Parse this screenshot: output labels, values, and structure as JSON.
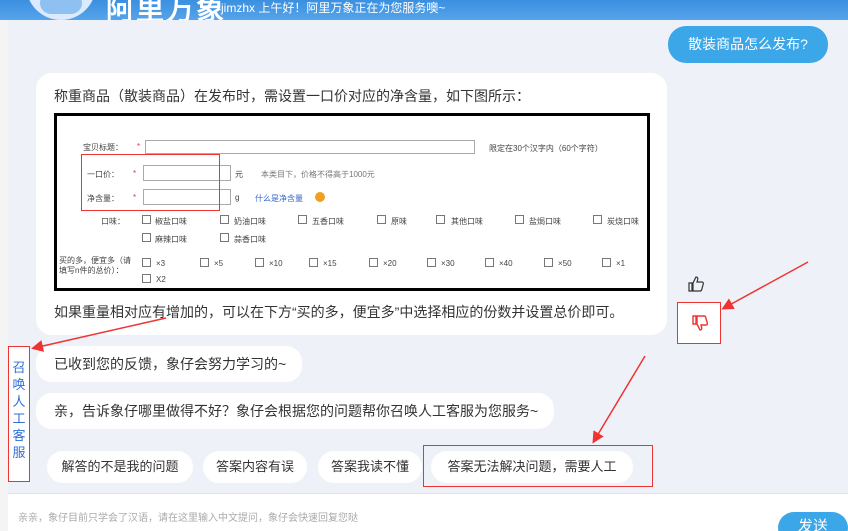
{
  "header": {
    "brand": "阿里万象",
    "greeting": "jimzhx 上午好！阿里万象正在为您服务噢~"
  },
  "user_message": "散装商品怎么发布?",
  "bot_answer": {
    "intro": "称重商品（散装商品）在发布时，需设置一口价对应的净含量，如下图所示：",
    "outro": "如果重量相对应有增加的，可以在下方“买的多，便宜多”中选择相应的份数并设置总价即可。"
  },
  "figure": {
    "title_label": "宝贝标题：",
    "title_hint": "限定在30个汉字内（60个字符）",
    "price_label": "一口价：",
    "price_unit": "元",
    "price_hint": "本类目下，价格不得高于1000元",
    "net_label": "净含量：",
    "net_unit": "g",
    "net_link": "什么是净含量",
    "flavor_label": "口味：",
    "flavors": [
      "椒盐口味",
      "奶油口味",
      "五香口味",
      "原味",
      "其他口味",
      "盐焗口味",
      "炭烧口味",
      "麻辣口味",
      "蒜香口味"
    ],
    "bulk_label": "买的多，便宜多（请填写n件的总价）：",
    "bulk_options": [
      "×3",
      "×5",
      "×10",
      "×15",
      "×20",
      "×30",
      "×40",
      "×50",
      "×1",
      "X2"
    ]
  },
  "feedback_ack": "已收到您的反馈，象仔会努力学习的~",
  "feedback_prompt": "亲，告诉象仔哪里做得不好？象仔会根据您的问题帮你召唤人工客服为您服务~",
  "options": [
    "解答的不是我的问题",
    "答案内容有误",
    "答案我读不懂",
    "答案无法解决问题，需要人工"
  ],
  "side_button": "召唤人工客服",
  "input": {
    "placeholder": "亲亲，象仔目前只学会了汉语，请在这里输入中文提问，象仔会快速回复您哒"
  },
  "send_label": "发送",
  "colors": {
    "accent": "#3ba6e8",
    "highlight": "#e33333",
    "link": "#2f6fd6"
  },
  "icons": {
    "like": "thumbs-up-icon",
    "dislike": "thumbs-down-icon"
  }
}
